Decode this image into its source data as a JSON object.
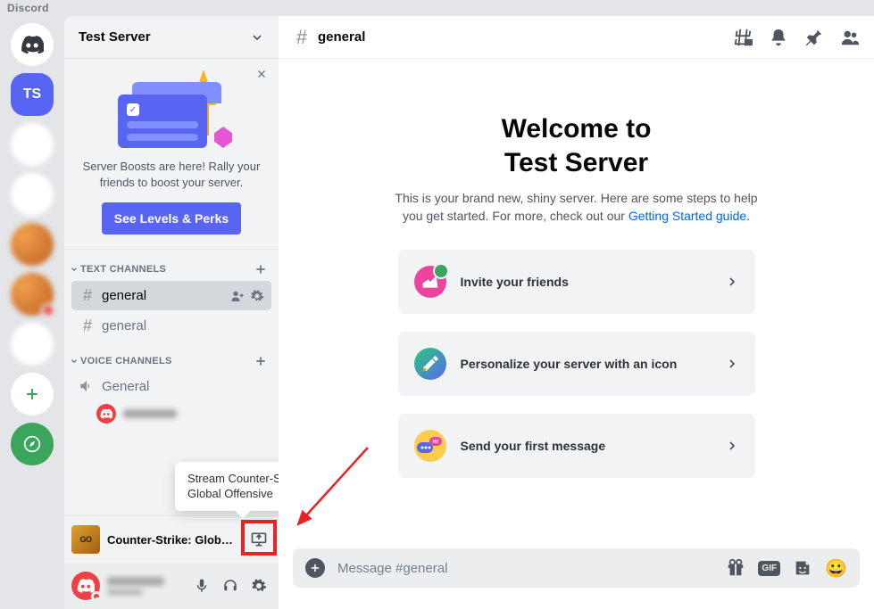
{
  "app_name": "Discord",
  "guilds": {
    "selected_initials": "TS"
  },
  "server": {
    "name": "Test Server",
    "boost": {
      "text": "Server Boosts are here! Rally your friends to boost your server.",
      "button": "See Levels & Perks"
    }
  },
  "categories": {
    "text": {
      "label": "TEXT CHANNELS"
    },
    "voice": {
      "label": "VOICE CHANNELS"
    }
  },
  "channels": {
    "general1": "general",
    "general2": "general",
    "voice_general": "General"
  },
  "playing": {
    "game_icon_text": "GO",
    "game": "Counter-Strike: Global ...",
    "tooltip": "Stream Counter-Strike: Global Offensive"
  },
  "header": {
    "channel": "general"
  },
  "welcome": {
    "title_line1": "Welcome to",
    "title_line2": "Test Server",
    "sub_prefix": "This is your brand new, shiny server. Here are some steps to help you get started. For more, check out our ",
    "sub_link": "Getting Started guide",
    "sub_suffix": "."
  },
  "cards": {
    "invite": "Invite your friends",
    "personalize": "Personalize your server with an icon",
    "message": "Send your first message"
  },
  "composer": {
    "placeholder": "Message #general",
    "gif": "GIF"
  }
}
